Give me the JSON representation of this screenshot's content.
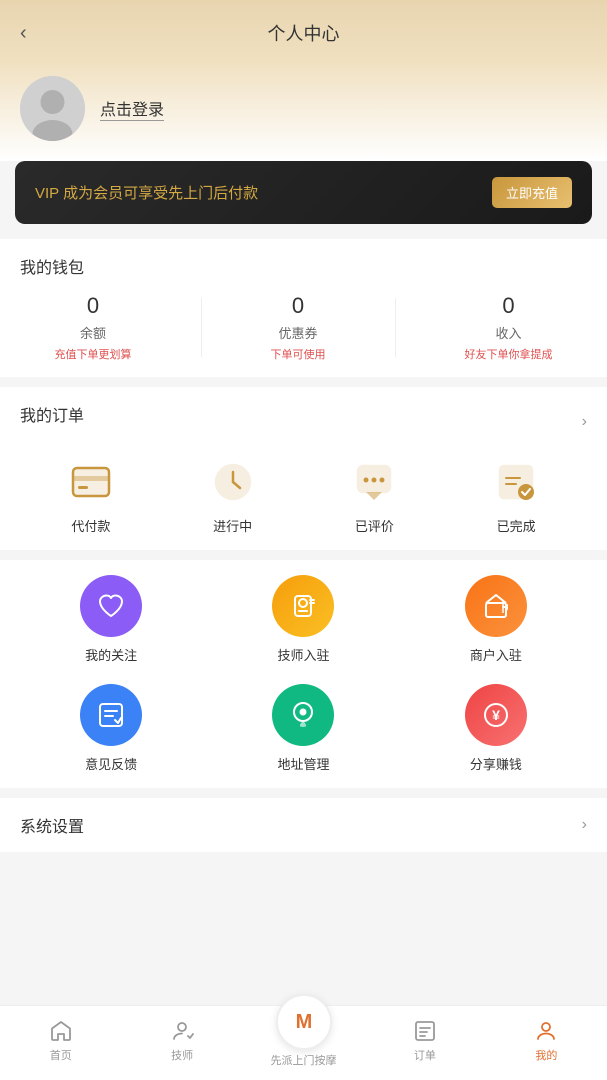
{
  "header": {
    "back_label": "‹",
    "title": "个人中心"
  },
  "profile": {
    "login_prompt": "点击登录"
  },
  "vip": {
    "text": "VIP 成为会员可享受先上门后付款",
    "button": "立即充值"
  },
  "wallet": {
    "title": "我的钱包",
    "items": [
      {
        "value": "0",
        "label": "余额",
        "sub": "充值下单更划算"
      },
      {
        "value": "0",
        "label": "优惠券",
        "sub": "下单可使用"
      },
      {
        "value": "0",
        "label": "收入",
        "sub": "好友下单你拿提成"
      }
    ]
  },
  "orders": {
    "title": "我的订单",
    "items": [
      {
        "label": "代付款"
      },
      {
        "label": "进行中"
      },
      {
        "label": "已评价"
      },
      {
        "label": "已完成"
      }
    ]
  },
  "features": {
    "items": [
      {
        "label": "我的关注",
        "color": "#8b5cf6",
        "icon": "heart"
      },
      {
        "label": "技师入驻",
        "color": "#f59e0b",
        "icon": "person-scan"
      },
      {
        "label": "商户入驻",
        "color": "#f97316",
        "icon": "store"
      },
      {
        "label": "意见反馈",
        "color": "#3b82f6",
        "icon": "edit"
      },
      {
        "label": "地址管理",
        "color": "#10b981",
        "icon": "location"
      },
      {
        "label": "分享赚钱",
        "color": "#ef4444",
        "icon": "money"
      }
    ]
  },
  "settings": {
    "title": "系统设置"
  },
  "bottom_nav": {
    "items": [
      {
        "label": "首页",
        "icon": "home",
        "active": false
      },
      {
        "label": "技师",
        "icon": "person",
        "active": false
      },
      {
        "label": "先派上门按摩",
        "icon": "logo",
        "active": false,
        "center": true
      },
      {
        "label": "订单",
        "icon": "list",
        "active": false
      },
      {
        "label": "我的",
        "icon": "user",
        "active": true
      }
    ]
  }
}
